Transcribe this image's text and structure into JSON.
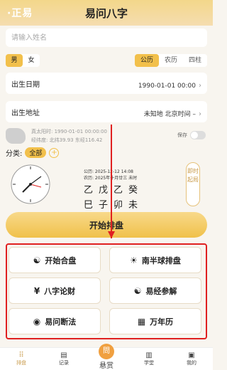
{
  "header": {
    "logo": "·正易",
    "title": "易问八字"
  },
  "form": {
    "name_placeholder": "请输入姓名",
    "gender": {
      "male": "男",
      "female": "女"
    },
    "calendar": {
      "solar": "公历",
      "lunar": "农历",
      "pillars": "四柱"
    },
    "birth_date": {
      "label": "出生日期",
      "value": "1990-01-01 00:00"
    },
    "birth_place": {
      "label": "出生地址",
      "value": "未知地 北京时间 –"
    },
    "true_solar": "真太阳时: 1990-01-01 00:00:00",
    "coords": "经纬度: 北纬39.93 东经116.42",
    "save_label": "保存",
    "category_label": "分类:",
    "category_chip": "全部",
    "category_add": "+"
  },
  "preview": {
    "gregorian": "公历: 2025-12-12 14:08",
    "lunar": "农历: 2025年十月廿三 未时",
    "stems": "乙戊乙癸",
    "branches": "巳子卯未",
    "instant_btn": "即时起局"
  },
  "start_button": "开始排盘",
  "features": [
    {
      "label": "开始合盘",
      "icon": "☯"
    },
    {
      "label": "南半球排盘",
      "icon": "☀"
    },
    {
      "label": "八字论财",
      "icon": "¥"
    },
    {
      "label": "易经参解",
      "icon": "☯"
    },
    {
      "label": "易问断法",
      "icon": "◉"
    },
    {
      "label": "万年历",
      "icon": "▦"
    }
  ],
  "tabs": [
    {
      "label": "排盘",
      "icon": "⠿"
    },
    {
      "label": "记录",
      "icon": "▤"
    },
    {
      "label": "悬赏",
      "icon": "問"
    },
    {
      "label": "学堂",
      "icon": "▥"
    },
    {
      "label": "我的",
      "icon": "▣"
    }
  ]
}
